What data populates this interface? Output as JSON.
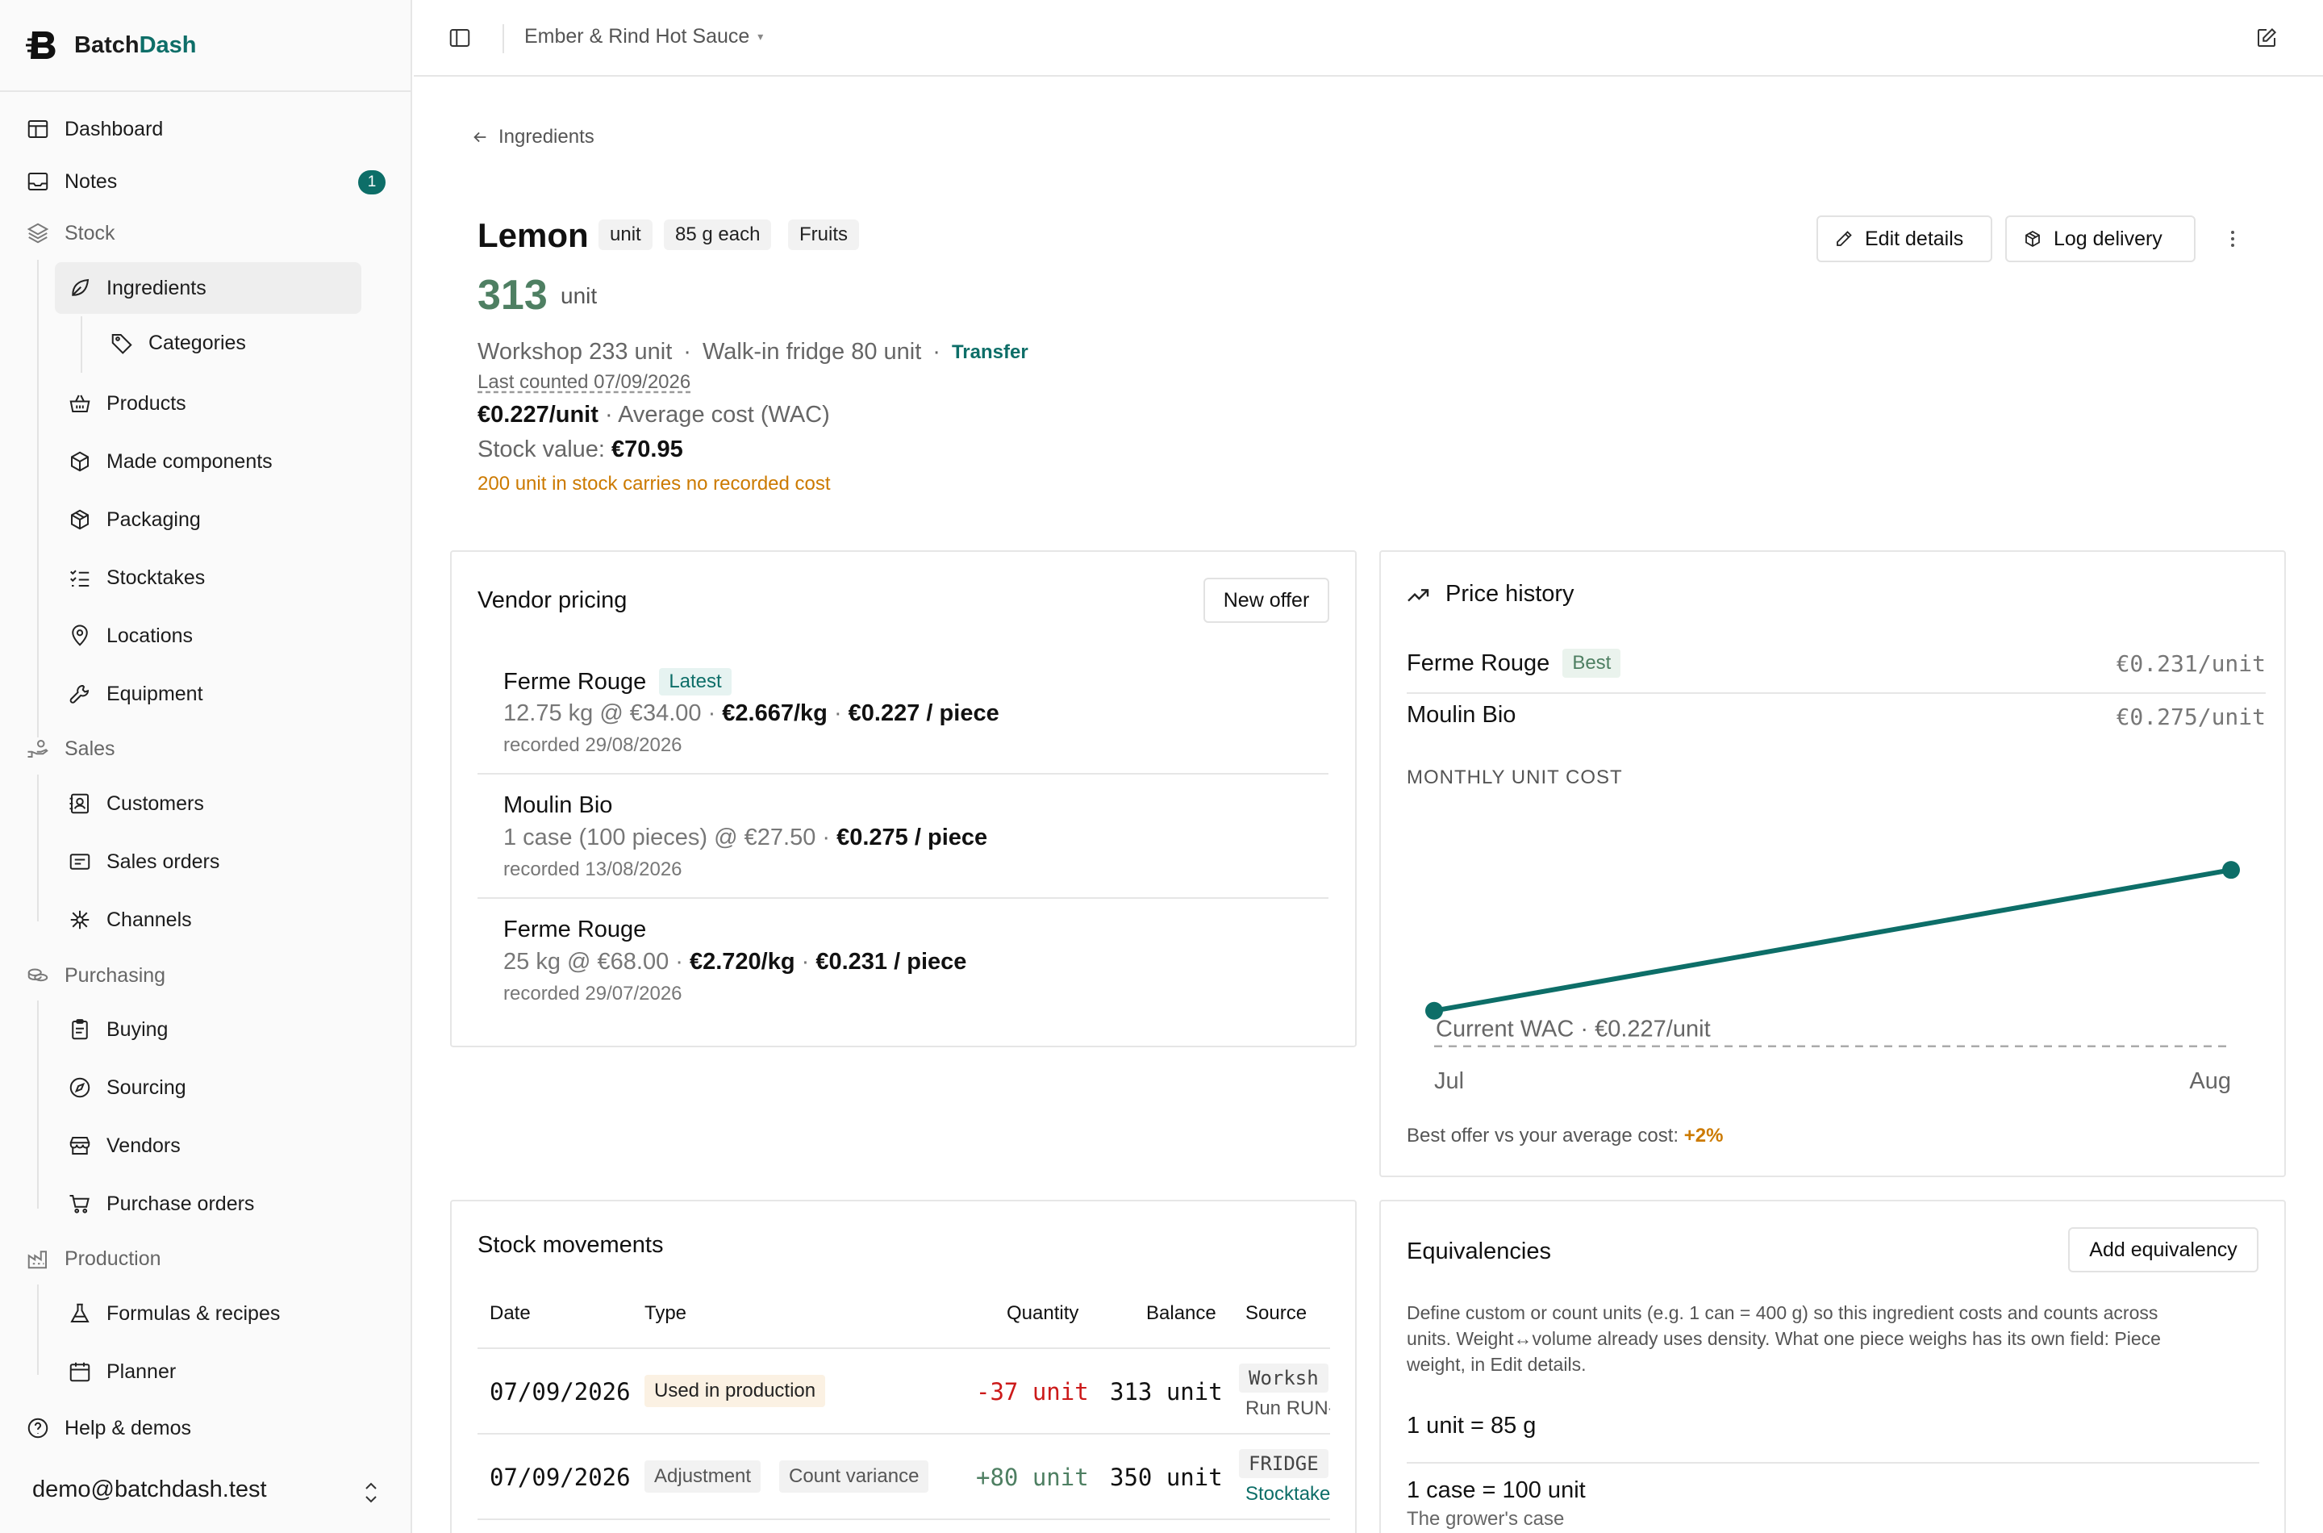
{
  "brand": {
    "name_a": "Batch",
    "name_b": "Dash"
  },
  "sidebar": {
    "dashboard": "Dashboard",
    "notes": "Notes",
    "notes_count": "1",
    "stock": "Stock",
    "ingredients": "Ingredients",
    "categories": "Categories",
    "products": "Products",
    "made_components": "Made components",
    "packaging": "Packaging",
    "stocktakes": "Stocktakes",
    "locations": "Locations",
    "equipment": "Equipment",
    "sales": "Sales",
    "customers": "Customers",
    "sales_orders": "Sales orders",
    "channels": "Channels",
    "purchasing": "Purchasing",
    "buying": "Buying",
    "sourcing": "Sourcing",
    "vendors": "Vendors",
    "purchase_orders": "Purchase orders",
    "production": "Production",
    "formulas": "Formulas & recipes",
    "planner": "Planner",
    "help": "Help & demos",
    "user_email": "demo@batchdash.test"
  },
  "topbar": {
    "business": "Ember & Rind Hot Sauce",
    "caret": "▾"
  },
  "page": {
    "back_label": "Ingredients",
    "title": "Lemon",
    "chips": [
      "unit",
      "85 g each",
      "Fruits"
    ],
    "qty": "313",
    "qty_unit": "unit",
    "loc_workshop": "Workshop 233 unit",
    "loc_fridge": "Walk-in fridge 80 unit",
    "sep": "·",
    "transfer": "Transfer",
    "last_counted": "Last counted 07/09/2026",
    "wac_value": "€0.227/unit",
    "wac_label": " · Average cost (WAC)",
    "stock_value_label": "Stock value: ",
    "stock_value": "€70.95",
    "warning": "200 unit in stock carries no recorded cost",
    "edit_btn": "Edit details",
    "log_btn": "Log delivery"
  },
  "vendor_pricing": {
    "title": "Vendor pricing",
    "new_offer": "New offer",
    "offers": [
      {
        "vendor": "Ferme Rouge",
        "badge": "Latest",
        "qty": "12.75 kg @ €34.00 · ",
        "per_kg": "€2.667/kg",
        "mid": " · ",
        "per_piece": "€0.227 / piece",
        "recorded": "recorded 29/08/2026"
      },
      {
        "vendor": "Moulin Bio",
        "badge": "",
        "qty": "1 case (100 pieces) @ €27.50 · ",
        "per_kg": "€0.275 / piece",
        "mid": "",
        "per_piece": "",
        "recorded": "recorded 13/08/2026"
      },
      {
        "vendor": "Ferme Rouge",
        "badge": "",
        "qty": "25 kg @ €68.00 · ",
        "per_kg": "€2.720/kg",
        "mid": " · ",
        "per_piece": "€0.231 / piece",
        "recorded": "recorded 29/07/2026"
      }
    ]
  },
  "price_history": {
    "title": "Price history",
    "rows": [
      {
        "vendor": "Ferme Rouge",
        "badge": "Best",
        "price": "€0.231/unit"
      },
      {
        "vendor": "Moulin Bio",
        "badge": "",
        "price": "€0.275/unit"
      }
    ],
    "subtitle": "MONTHLY UNIT COST",
    "wac_line_label": "Current WAC · €0.227/unit",
    "footer_label": "Best offer vs your average cost: ",
    "footer_value": "+2%"
  },
  "chart_data": {
    "type": "line",
    "categories": [
      "Jul",
      "Aug"
    ],
    "series": [
      {
        "values": [
          0.227,
          0.275
        ]
      }
    ],
    "reference_line": {
      "label": "Current WAC · €0.227/unit",
      "value": 0.227
    },
    "ylim": [
      0.225,
      0.28
    ],
    "color": "#0d6e68"
  },
  "movements": {
    "title": "Stock movements",
    "headers": {
      "date": "Date",
      "type": "Type",
      "qty": "Quantity",
      "balance": "Balance",
      "source": "Source"
    },
    "rows": [
      {
        "date": "07/09/2026",
        "type": "Used in production",
        "type2": "",
        "qty": "-37 unit",
        "balance": "313 unit",
        "source": "Worksh",
        "source2": "Run RUN-"
      },
      {
        "date": "07/09/2026",
        "type": "Adjustment",
        "type2": "Count variance",
        "qty": "+80 unit",
        "balance": "350 unit",
        "source": "FRIDGE",
        "source2": "Stocktake"
      }
    ]
  },
  "equivalencies": {
    "title": "Equivalencies",
    "add_btn": "Add equivalency",
    "desc1": "Define custom or count units (e.g. 1 can = 400 g) so this ingredient costs and counts across",
    "desc2": "units. Weight↔volume already uses density. What one piece weighs has its own field: Piece",
    "desc3": "weight, in Edit details.",
    "eq1": "1 unit = 85 g",
    "eq2": "1 case = 100 unit",
    "eq2_note": "The grower's case"
  },
  "colors": {
    "accent": "#0d6e68",
    "green": "#4e7f62",
    "warn": "#cc7a00",
    "neg": "#cc1a1a"
  }
}
